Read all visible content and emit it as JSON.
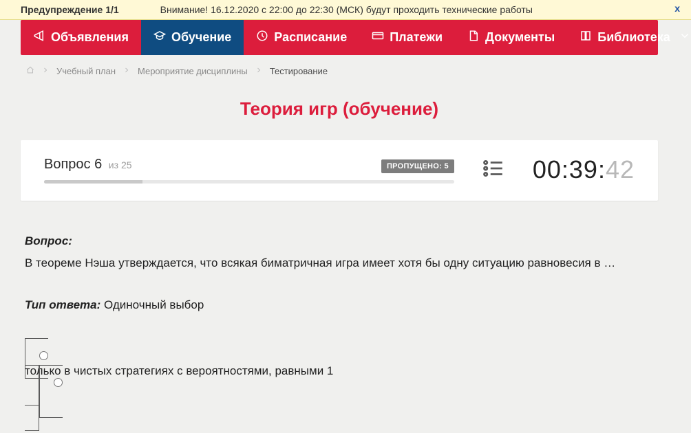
{
  "warning": {
    "title": "Предупреждение 1/1",
    "message": "Внимание! 16.12.2020 с 22:00 до 22:30 (МСК) будут проходить технические работы",
    "close": "x"
  },
  "nav": {
    "items": [
      {
        "label": "Объявления",
        "icon": "megaphone"
      },
      {
        "label": "Обучение",
        "icon": "graduation",
        "active": true
      },
      {
        "label": "Расписание",
        "icon": "clock"
      },
      {
        "label": "Платежи",
        "icon": "card"
      },
      {
        "label": "Документы",
        "icon": "file"
      },
      {
        "label": "Библиотека",
        "icon": "book",
        "dropdown": true
      }
    ]
  },
  "breadcrumbs": {
    "items": [
      {
        "label": "Учебный план"
      },
      {
        "label": "Мероприятие дисциплины"
      }
    ],
    "current": "Тестирование"
  },
  "page_title": "Теория игр (обучение)",
  "status": {
    "question_word": "Вопрос",
    "question_num": "6",
    "of_word": "из",
    "total": "25",
    "skipped_label": "ПРОПУЩЕНО: 5",
    "timer_main": "00:39:",
    "timer_ms": "42"
  },
  "question": {
    "label": "Вопрос:",
    "text": "В теореме Нэша утверждается, что всякая биматричная игра имеет хотя бы одну ситуацию равновесия в …",
    "answer_type_label": "Тип ответа:",
    "answer_type_value": "Одиночный выбор"
  },
  "answers": [
    {
      "text": "только в чистых стратегиях с вероятностями, равными 1"
    }
  ]
}
